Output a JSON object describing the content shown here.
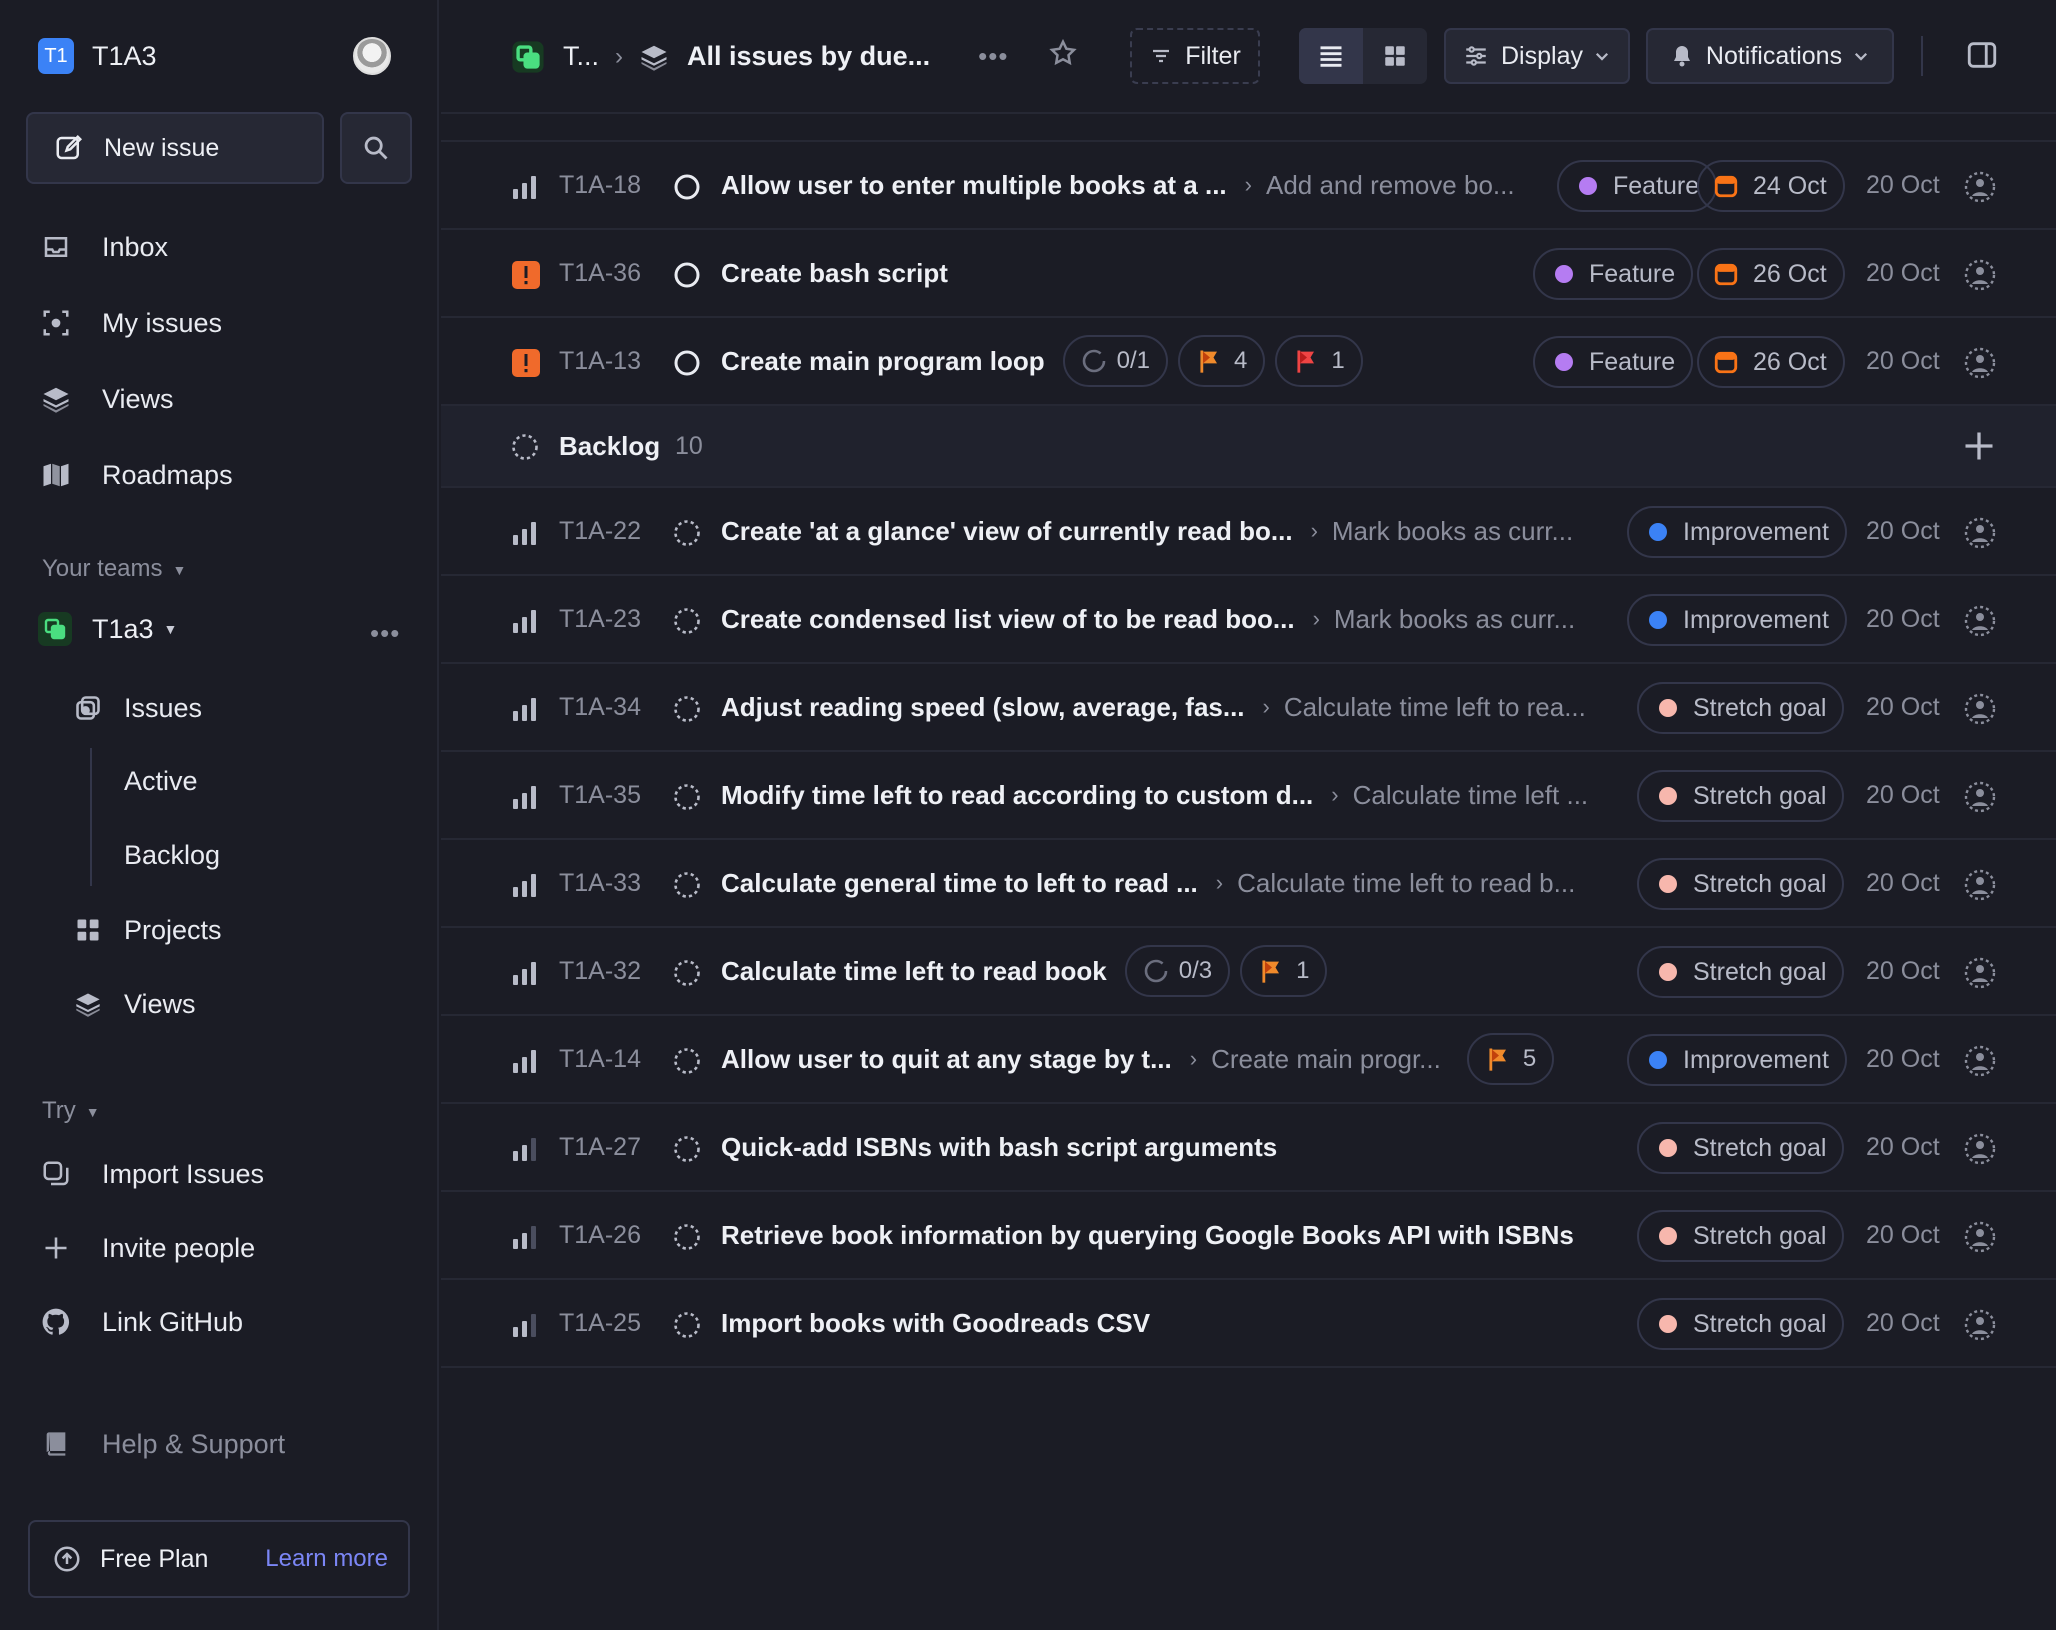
{
  "sidebar": {
    "workspace_badge": "T1",
    "workspace_name": "T1A3",
    "new_issue_label": "New issue",
    "nav": {
      "inbox": "Inbox",
      "my_issues": "My issues",
      "views": "Views",
      "roadmaps": "Roadmaps"
    },
    "your_teams_label": "Your teams",
    "team_name": "T1a3",
    "team_items": {
      "issues": "Issues",
      "active": "Active",
      "backlog": "Backlog",
      "projects": "Projects",
      "views": "Views"
    },
    "try_label": "Try",
    "try_items": {
      "import": "Import Issues",
      "invite": "Invite people",
      "github": "Link GitHub"
    },
    "help": "Help & Support",
    "plan_label": "Free Plan",
    "plan_link": "Learn more"
  },
  "topbar": {
    "team_crumb": "T...",
    "view_crumb": "All issues by due...",
    "filter": "Filter",
    "display": "Display",
    "notifications": "Notifications"
  },
  "colors": {
    "feature": "#b57cf2",
    "improvement": "#3b82f6",
    "stretch": "#f7b7ad",
    "urgent": "#f06a2b",
    "accent_link": "#7b86f5"
  },
  "todo_rows": [
    {
      "id": "T1A-18",
      "priority": "medium",
      "title": "Allow user to enter multiple books at a ...",
      "parent": "Add and remove bo...",
      "label": "Feature",
      "due": "24 Oct",
      "created": "20 Oct"
    },
    {
      "id": "T1A-36",
      "priority": "urgent",
      "title": "Create bash script",
      "parent": "",
      "label": "Feature",
      "due": "26 Oct",
      "created": "20 Oct"
    },
    {
      "id": "T1A-13",
      "priority": "urgent",
      "title": "Create main program loop",
      "sub_issues": "0/1",
      "flag_a": "4",
      "flag_b": "1",
      "label": "Feature",
      "due": "26 Oct",
      "created": "20 Oct"
    }
  ],
  "backlog": {
    "name": "Backlog",
    "count": "10"
  },
  "backlog_rows": [
    {
      "id": "T1A-22",
      "priority": "medium",
      "title": "Create 'at a glance' view of currently read bo...",
      "parent": "Mark books as curr...",
      "label": "Improvement",
      "created": "20 Oct"
    },
    {
      "id": "T1A-23",
      "priority": "medium",
      "title": "Create condensed list view of to be read boo...",
      "parent": "Mark books as curr...",
      "label": "Improvement",
      "created": "20 Oct"
    },
    {
      "id": "T1A-34",
      "priority": "medium",
      "title": "Adjust reading speed (slow, average, fas...",
      "parent": "Calculate time left to rea...",
      "label": "Stretch goal",
      "created": "20 Oct"
    },
    {
      "id": "T1A-35",
      "priority": "medium",
      "title": "Modify time left to read according to custom d...",
      "parent": "Calculate time left ...",
      "label": "Stretch goal",
      "created": "20 Oct"
    },
    {
      "id": "T1A-33",
      "priority": "medium",
      "title": "Calculate general time to left to read ...",
      "parent": "Calculate time left to read b...",
      "label": "Stretch goal",
      "created": "20 Oct"
    },
    {
      "id": "T1A-32",
      "priority": "medium",
      "title": "Calculate time left to read book",
      "sub_issues": "0/3",
      "flag_a": "1",
      "label": "Stretch goal",
      "created": "20 Oct"
    },
    {
      "id": "T1A-14",
      "priority": "medium",
      "title": "Allow user to quit at any stage by t...",
      "parent": "Create main progr...",
      "flag_a": "5",
      "label": "Improvement",
      "created": "20 Oct"
    },
    {
      "id": "T1A-27",
      "priority": "low",
      "title": "Quick-add ISBNs with bash script arguments",
      "label": "Stretch goal",
      "created": "20 Oct"
    },
    {
      "id": "T1A-26",
      "priority": "low",
      "title": "Retrieve book information by querying Google Books API with ISBNs",
      "label": "Stretch goal",
      "created": "20 Oct"
    },
    {
      "id": "T1A-25",
      "priority": "low",
      "title": "Import books with Goodreads CSV",
      "label": "Stretch goal",
      "created": "20 Oct"
    }
  ]
}
